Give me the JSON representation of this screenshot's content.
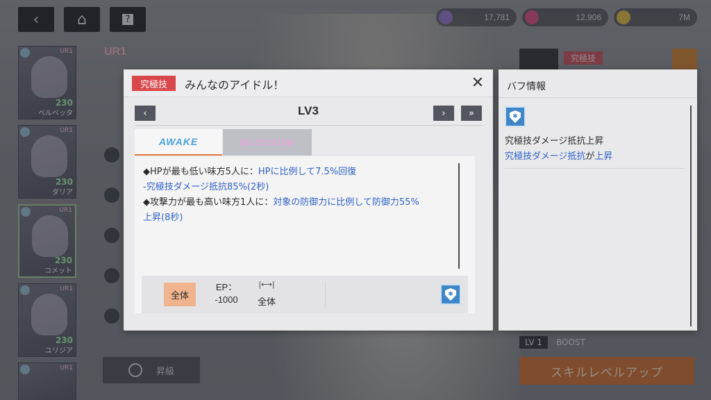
{
  "resources": [
    {
      "name": "stamina-icon",
      "value": "17,781",
      "color": "#8c6fc4"
    },
    {
      "name": "gem-icon",
      "value": "12,906",
      "color": "#d6457a"
    },
    {
      "name": "coin-icon",
      "value": "7M",
      "color": "#d9b23a"
    }
  ],
  "character": {
    "rarity": "UR1"
  },
  "roster": [
    {
      "rarity": "UR1",
      "level": "230",
      "name": "ベルベッタ"
    },
    {
      "rarity": "UR1",
      "level": "230",
      "name": "ダリア"
    },
    {
      "rarity": "UR1",
      "level": "230",
      "name": "コメット"
    },
    {
      "rarity": "UR1",
      "level": "230",
      "name": "ユリジア"
    },
    {
      "rarity": "UR1",
      "level": "",
      "name": ""
    }
  ],
  "side": {
    "upgrade_label": "昇級",
    "skill_tag": "究極技",
    "lv_label": "LV 1",
    "boost_label": "BOOST",
    "skill_level_up": "スキルレベルアップ"
  },
  "modal": {
    "tag": "究極技",
    "title": "みんなのアイドル！",
    "close": "✕",
    "prev": "‹",
    "next": "›",
    "last": "»",
    "level": "LV3",
    "tabs": [
      "AWAKE",
      "BLOSSOM"
    ],
    "description": {
      "line1_prefix": "◆HPが最も低い味方5人に：",
      "line1_hl": "HPに比例して7.5%回復",
      "line2": "-究極技ダメージ抵抗85%(2秒)",
      "line3_prefix": "◆攻撃力が最も高い味方1人に：",
      "line3_hl": "対象の防御力に比例して防御力55%",
      "line4": "上昇(8秒)"
    },
    "footer": {
      "target": "全体",
      "ep_label": "EP：",
      "ep_value": "-1000",
      "range_icon": "|⟷|",
      "range_value": "全体"
    }
  },
  "buff_panel": {
    "title": "バフ情報",
    "buff_name": "究極技ダメージ抵抗上昇",
    "buff_desc_a": "究極技ダメージ抵抗",
    "buff_desc_b": "が",
    "buff_desc_c": "上昇"
  }
}
